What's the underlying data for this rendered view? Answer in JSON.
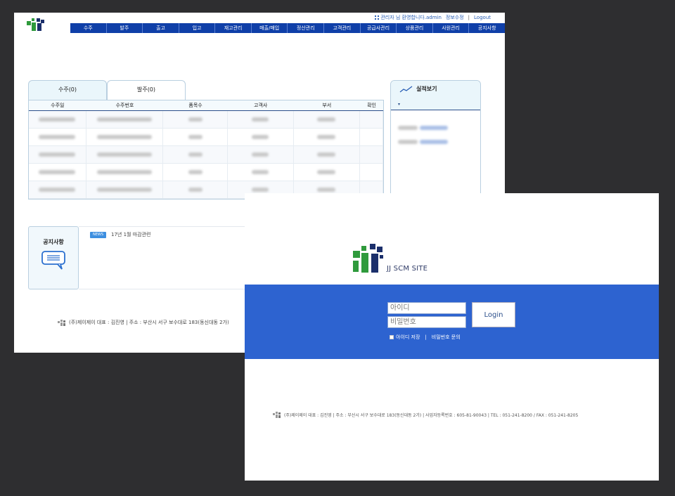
{
  "dashboard": {
    "top_links": {
      "welcome": "관리자 님 환영합니다.admin",
      "edit_info": "정보수정",
      "sep": "|",
      "logout": "Logout"
    },
    "nav": [
      "수주",
      "발주",
      "출고",
      "입고",
      "재고관리",
      "매출/매입",
      "정산관리",
      "고객관리",
      "공급사관리",
      "상품관리",
      "사원관리",
      "공지사항"
    ],
    "tabs": {
      "orders": "수주(0)",
      "purchases": "발주(0)"
    },
    "table_headers": [
      "수주일",
      "수주번호",
      "품목수",
      "고객사",
      "부서",
      "확인"
    ],
    "performance": {
      "title": "실적보기",
      "caret": "▾"
    },
    "notice": {
      "title": "공지사항",
      "badge": "NEWS",
      "item": "17년 1월 마감관련"
    },
    "footer": "(주)제이제이 대표 : 김진영 | 주소 : 부산시 서구 보수대로 183(동신대동 2가)"
  },
  "login": {
    "site_name": "JJ SCM SITE",
    "id_placeholder": "아이디",
    "pw_placeholder": "비밀번호",
    "login_button": "Login",
    "remember_id": "아이디 저장",
    "separator": "|",
    "password_inquiry": "비밀번호 문의",
    "footer": "(주)제이제이 대표 : 김진영 | 주소 : 부산시 서구 보수대로 183(동신대동 2가) | 사업자등록번호 : 605-81-90043 | TEL : 051-241-8200 / FAX : 051-241-8205"
  },
  "colors": {
    "brand_blue": "#0f3fa8",
    "login_band": "#2d63d0",
    "logo_green": "#2f9a3c",
    "logo_navy": "#1b2f6b",
    "news_badge": "#3d8fe0"
  }
}
